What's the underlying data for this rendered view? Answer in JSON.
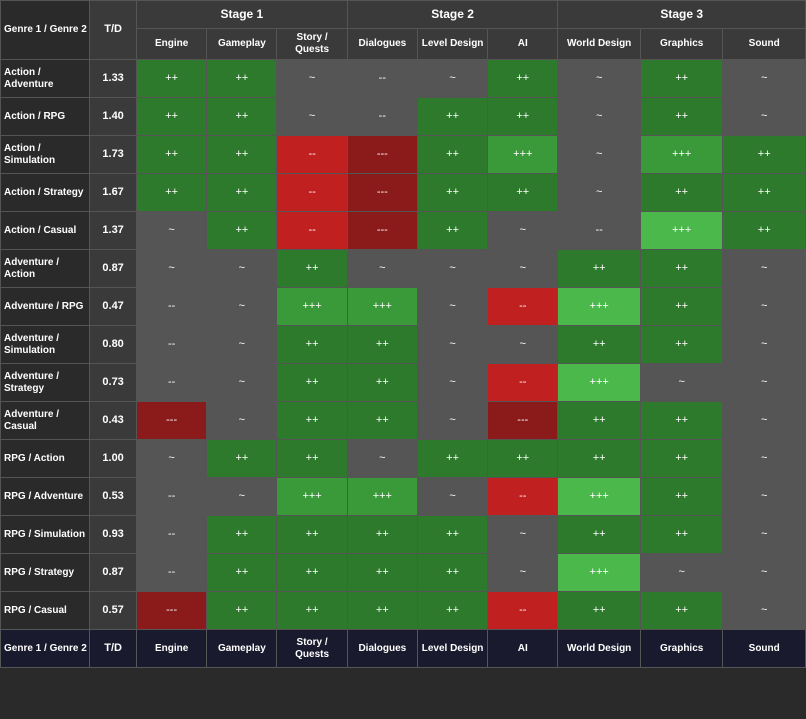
{
  "table": {
    "stage1_label": "Stage 1",
    "stage2_label": "Stage 2",
    "stage3_label": "Stage 3",
    "col_genre": "Genre 1 / Genre 2",
    "col_td": "T/D",
    "sub_cols": {
      "stage1": [
        "Engine",
        "Gameplay",
        "Story / Quests"
      ],
      "stage2": [
        "Dialogues",
        "Level Design",
        "AI"
      ],
      "stage3": [
        "World Design",
        "Graphics",
        "Sound"
      ]
    },
    "rows": [
      {
        "genre": "Action / Adventure",
        "td": "1.33",
        "s1e": "++",
        "s1e_c": "green-dark",
        "s1g": "++",
        "s1g_c": "green-dark",
        "s1s": "~",
        "s1s_c": "neutral",
        "s2d": "--",
        "s2d_c": "neutral",
        "s2l": "~",
        "s2l_c": "neutral",
        "s2a": "++",
        "s2a_c": "green-dark",
        "s3w": "~",
        "s3w_c": "neutral",
        "s3g": "++",
        "s3g_c": "green-dark",
        "s3s": "~",
        "s3s_c": "neutral"
      },
      {
        "genre": "Action / RPG",
        "td": "1.40",
        "s1e": "++",
        "s1e_c": "green-dark",
        "s1g": "++",
        "s1g_c": "green-dark",
        "s1s": "~",
        "s1s_c": "neutral",
        "s2d": "--",
        "s2d_c": "neutral",
        "s2l": "++",
        "s2l_c": "green-dark",
        "s2a": "++",
        "s2a_c": "green-dark",
        "s3w": "~",
        "s3w_c": "neutral",
        "s3g": "++",
        "s3g_c": "green-dark",
        "s3s": "~",
        "s3s_c": "neutral"
      },
      {
        "genre": "Action / Simulation",
        "td": "1.73",
        "s1e": "++",
        "s1e_c": "green-dark",
        "s1g": "++",
        "s1g_c": "green-dark",
        "s1s": "--",
        "s1s_c": "red-medium",
        "s2d": "---",
        "s2d_c": "red-dark",
        "s2l": "++",
        "s2l_c": "green-dark",
        "s2a": "+++",
        "s2a_c": "green-medium",
        "s3w": "~",
        "s3w_c": "neutral",
        "s3g": "+++",
        "s3g_c": "green-medium",
        "s3s": "++",
        "s3s_c": "green-dark"
      },
      {
        "genre": "Action / Strategy",
        "td": "1.67",
        "s1e": "++",
        "s1e_c": "green-dark",
        "s1g": "++",
        "s1g_c": "green-dark",
        "s1s": "--",
        "s1s_c": "red-medium",
        "s2d": "---",
        "s2d_c": "red-dark",
        "s2l": "++",
        "s2l_c": "green-dark",
        "s2a": "++",
        "s2a_c": "green-dark",
        "s3w": "~",
        "s3w_c": "neutral",
        "s3g": "++",
        "s3g_c": "green-dark",
        "s3s": "++",
        "s3s_c": "green-dark"
      },
      {
        "genre": "Action / Casual",
        "td": "1.37",
        "s1e": "~",
        "s1e_c": "neutral",
        "s1g": "++",
        "s1g_c": "green-dark",
        "s1s": "--",
        "s1s_c": "red-medium",
        "s2d": "---",
        "s2d_c": "red-dark",
        "s2l": "++",
        "s2l_c": "green-dark",
        "s2a": "~",
        "s2a_c": "neutral",
        "s3w": "--",
        "s3w_c": "neutral",
        "s3g": "+++",
        "s3g_c": "green-light",
        "s3s": "++",
        "s3s_c": "green-dark"
      },
      {
        "genre": "Adventure / Action",
        "td": "0.87",
        "s1e": "~",
        "s1e_c": "neutral",
        "s1g": "~",
        "s1g_c": "neutral",
        "s1s": "++",
        "s1s_c": "green-dark",
        "s2d": "~",
        "s2d_c": "neutral",
        "s2l": "~",
        "s2l_c": "neutral",
        "s2a": "~",
        "s2a_c": "neutral",
        "s3w": "++",
        "s3w_c": "green-dark",
        "s3g": "++",
        "s3g_c": "green-dark",
        "s3s": "~",
        "s3s_c": "neutral"
      },
      {
        "genre": "Adventure / RPG",
        "td": "0.47",
        "s1e": "--",
        "s1e_c": "neutral",
        "s1g": "~",
        "s1g_c": "neutral",
        "s1s": "+++",
        "s1s_c": "green-medium",
        "s2d": "+++",
        "s2d_c": "green-medium",
        "s2l": "~",
        "s2l_c": "neutral",
        "s2a": "--",
        "s2a_c": "red-medium",
        "s3w": "+++",
        "s3w_c": "green-light",
        "s3g": "++",
        "s3g_c": "green-dark",
        "s3s": "~",
        "s3s_c": "neutral"
      },
      {
        "genre": "Adventure / Simulation",
        "td": "0.80",
        "s1e": "--",
        "s1e_c": "neutral",
        "s1g": "~",
        "s1g_c": "neutral",
        "s1s": "++",
        "s1s_c": "green-dark",
        "s2d": "++",
        "s2d_c": "green-dark",
        "s2l": "~",
        "s2l_c": "neutral",
        "s2a": "~",
        "s2a_c": "neutral",
        "s3w": "++",
        "s3w_c": "green-dark",
        "s3g": "++",
        "s3g_c": "green-dark",
        "s3s": "~",
        "s3s_c": "neutral"
      },
      {
        "genre": "Adventure / Strategy",
        "td": "0.73",
        "s1e": "--",
        "s1e_c": "neutral",
        "s1g": "~",
        "s1g_c": "neutral",
        "s1s": "++",
        "s1s_c": "green-dark",
        "s2d": "++",
        "s2d_c": "green-dark",
        "s2l": "~",
        "s2l_c": "neutral",
        "s2a": "--",
        "s2a_c": "red-medium",
        "s3w": "+++",
        "s3w_c": "green-light",
        "s3g": "~",
        "s3g_c": "neutral",
        "s3s": "~",
        "s3s_c": "neutral"
      },
      {
        "genre": "Adventure / Casual",
        "td": "0.43",
        "s1e": "---",
        "s1e_c": "red-dark",
        "s1g": "~",
        "s1g_c": "neutral",
        "s1s": "++",
        "s1s_c": "green-dark",
        "s2d": "++",
        "s2d_c": "green-dark",
        "s2l": "~",
        "s2l_c": "neutral",
        "s2a": "---",
        "s2a_c": "red-dark",
        "s3w": "++",
        "s3w_c": "green-dark",
        "s3g": "++",
        "s3g_c": "green-dark",
        "s3s": "~",
        "s3s_c": "neutral"
      },
      {
        "genre": "RPG / Action",
        "td": "1.00",
        "s1e": "~",
        "s1e_c": "neutral",
        "s1g": "++",
        "s1g_c": "green-dark",
        "s1s": "++",
        "s1s_c": "green-dark",
        "s2d": "~",
        "s2d_c": "neutral",
        "s2l": "++",
        "s2l_c": "green-dark",
        "s2a": "++",
        "s2a_c": "green-dark",
        "s3w": "++",
        "s3w_c": "green-dark",
        "s3g": "++",
        "s3g_c": "green-dark",
        "s3s": "~",
        "s3s_c": "neutral"
      },
      {
        "genre": "RPG / Adventure",
        "td": "0.53",
        "s1e": "--",
        "s1e_c": "neutral",
        "s1g": "~",
        "s1g_c": "neutral",
        "s1s": "+++",
        "s1s_c": "green-medium",
        "s2d": "+++",
        "s2d_c": "green-medium",
        "s2l": "~",
        "s2l_c": "neutral",
        "s2a": "--",
        "s2a_c": "red-medium",
        "s3w": "+++",
        "s3w_c": "green-light",
        "s3g": "++",
        "s3g_c": "green-dark",
        "s3s": "~",
        "s3s_c": "neutral"
      },
      {
        "genre": "RPG / Simulation",
        "td": "0.93",
        "s1e": "--",
        "s1e_c": "neutral",
        "s1g": "++",
        "s1g_c": "green-dark",
        "s1s": "++",
        "s1s_c": "green-dark",
        "s2d": "++",
        "s2d_c": "green-dark",
        "s2l": "++",
        "s2l_c": "green-dark",
        "s2a": "~",
        "s2a_c": "neutral",
        "s3w": "++",
        "s3w_c": "green-dark",
        "s3g": "++",
        "s3g_c": "green-dark",
        "s3s": "~",
        "s3s_c": "neutral"
      },
      {
        "genre": "RPG / Strategy",
        "td": "0.87",
        "s1e": "--",
        "s1e_c": "neutral",
        "s1g": "++",
        "s1g_c": "green-dark",
        "s1s": "++",
        "s1s_c": "green-dark",
        "s2d": "++",
        "s2d_c": "green-dark",
        "s2l": "++",
        "s2l_c": "green-dark",
        "s2a": "~",
        "s2a_c": "neutral",
        "s3w": "+++",
        "s3w_c": "green-light",
        "s3g": "~",
        "s3g_c": "neutral",
        "s3s": "~",
        "s3s_c": "neutral"
      },
      {
        "genre": "RPG / Casual",
        "td": "0.57",
        "s1e": "---",
        "s1e_c": "red-dark",
        "s1g": "++",
        "s1g_c": "green-dark",
        "s1s": "++",
        "s1s_c": "green-dark",
        "s2d": "++",
        "s2d_c": "green-dark",
        "s2l": "++",
        "s2l_c": "green-dark",
        "s2a": "--",
        "s2a_c": "red-medium",
        "s3w": "++",
        "s3w_c": "green-dark",
        "s3g": "++",
        "s3g_c": "green-dark",
        "s3s": "~",
        "s3s_c": "neutral"
      }
    ],
    "footer": {
      "genre": "Genre 1 / Genre 2",
      "td": "T/D",
      "sub_cols": {
        "stage1": [
          "Engine",
          "Gameplay",
          "Story / Quests"
        ],
        "stage2": [
          "Dialogues",
          "Level Design",
          "AI"
        ],
        "stage3": [
          "World Design",
          "Graphics",
          "Sound"
        ]
      }
    }
  }
}
